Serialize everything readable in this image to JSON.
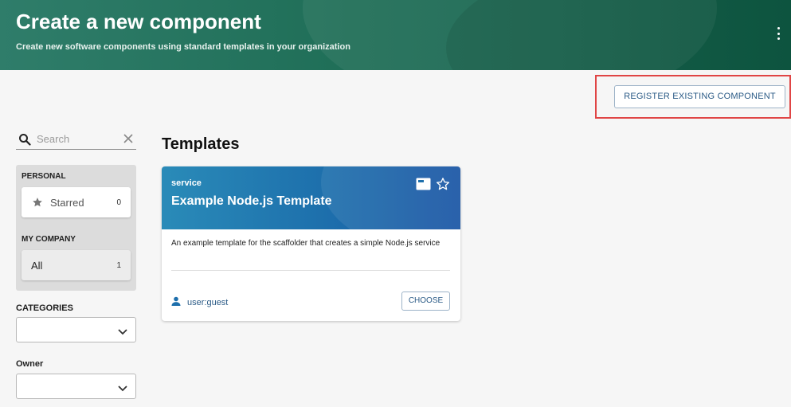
{
  "header": {
    "title": "Create a new component",
    "subtitle": "Create new software components using standard templates in your organization",
    "menu_icon": "kebab-menu-icon"
  },
  "actions": {
    "register_label": "REGISTER EXISTING COMPONENT"
  },
  "sidebar": {
    "search": {
      "placeholder": "Search",
      "icon": "search-icon",
      "clear_icon": "close-icon"
    },
    "personal": {
      "heading": "PERSONAL",
      "items": [
        {
          "label": "Starred",
          "count": "0",
          "icon": "star-icon"
        }
      ]
    },
    "company": {
      "heading": "MY COMPANY",
      "items": [
        {
          "label": "All",
          "count": "1"
        }
      ]
    },
    "categories": {
      "label": "CATEGORIES",
      "value": ""
    },
    "owner": {
      "label": "Owner",
      "value": ""
    }
  },
  "main": {
    "title": "Templates",
    "cards": [
      {
        "type": "service",
        "name": "Example Node.js Template",
        "description": "An example template for the scaffolder that creates a simple Node.js service",
        "owner": "user:guest",
        "choose_label": "CHOOSE"
      }
    ]
  },
  "colors": {
    "header_bg": "#1f6e57",
    "card_header_bg": "#1d6fac",
    "link": "#2a5a86",
    "highlight": "#e04545"
  }
}
